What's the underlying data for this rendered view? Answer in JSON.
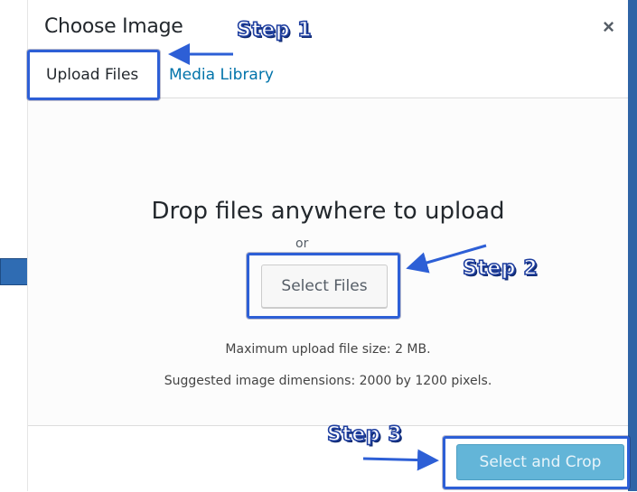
{
  "dialog": {
    "title": "Choose Image",
    "close_symbol": "×",
    "close_icon": "close-icon"
  },
  "tabs": [
    {
      "label": "Upload Files",
      "active": true
    },
    {
      "label": "Media Library",
      "active": false
    }
  ],
  "upload": {
    "drop_heading": "Drop files anywhere to upload",
    "or_text": "or",
    "select_button": "Select Files",
    "max_size": "Maximum upload file size: 2 MB.",
    "suggested": "Suggested image dimensions: 2000 by 1200 pixels."
  },
  "footer": {
    "crop_button": "Select and Crop"
  },
  "annotations": {
    "step1": "Step 1",
    "step2": "Step 2",
    "step3": "Step 3",
    "color": "#2d5fd6"
  },
  "colors": {
    "link": "#0073aa",
    "primary_button": "#63b5d8"
  }
}
